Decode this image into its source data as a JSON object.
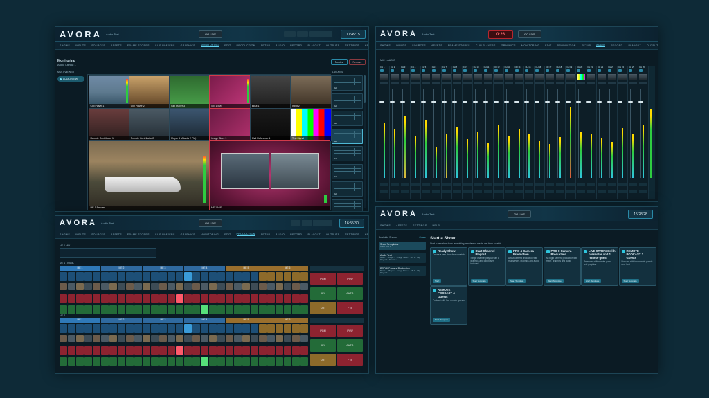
{
  "colors": {
    "accent": "#2fc6de",
    "bg": "#0e2a37",
    "red": "#c7303b",
    "green": "#2e9b47",
    "blue": "#28628f",
    "gold": "#9a6f2d"
  },
  "brand": {
    "logo": "AVORA",
    "sub": "Audio Test"
  },
  "common": {
    "go_live": "GO LIVE"
  },
  "panel_a": {
    "clock": "17:45:15",
    "nav": [
      "SHOWS",
      "INPUTS",
      "SOURCES",
      "ASSETS",
      "FRAME STORES",
      "CLIP PLAYERS",
      "GRAPHICS",
      "MONITORING",
      "EDIT",
      "PRODUCTION",
      "SETUP",
      "AUDIO",
      "RECORD",
      "PLAYOUT",
      "OUTPUTS",
      "SETTINGS",
      "HELP"
    ],
    "active_nav": "MONITORING",
    "title": "Monitoring",
    "subtitle": "Audio Layout 1",
    "sidebar_label": "MULTIVIEWER",
    "sidebar_item": "AUDIO VIEW",
    "action_primary": "Preview",
    "action_secondary": "Remove",
    "layouts_label": "LAYOUTS",
    "tiles": [
      {
        "label": "Clip Player 1",
        "sub": "Clip Player 1"
      },
      {
        "label": "Clip Player 2",
        "sub": "Clip Player 2"
      },
      {
        "label": "Clip Player 3",
        "sub": "Clip Player 3"
      },
      {
        "label": "ME 1 M/E",
        "sub": "ME 1 M/E"
      },
      {
        "label": "Input 1",
        "sub": "Input 1"
      },
      {
        "label": "Input 2",
        "sub": "Input 2"
      },
      {
        "label": "Remote Contributor 1",
        "sub": "Remote Contributor 1"
      },
      {
        "label": "Remote Contributor 2",
        "sub": "Remote Contributor 2"
      },
      {
        "label": "Player 4 (Atlanta 2 PM)",
        "sub": "Player 4 (Atlanta 2 PM)"
      },
      {
        "label": "Image Store 1",
        "sub": "Image Store 1"
      },
      {
        "label": "Mv1 Reference 1",
        "sub": "Mv1 Reference 1"
      },
      {
        "label": "Test Signal",
        "sub": "Test Signal"
      }
    ],
    "big_left": {
      "label": "ME 1 Preview",
      "caption": "ME 1 Preview"
    },
    "big_right": {
      "label": "ME 1 M/E",
      "caption": "ME 1 M/E"
    },
    "layout_labels": [
      "3x3",
      "3x3",
      "3x3",
      "4x4",
      "3x3",
      "4x4",
      "3x3",
      "3x3"
    ]
  },
  "panel_b": {
    "timer": "0:26",
    "nav": [
      "SHOWS",
      "INPUTS",
      "SOURCES",
      "ASSETS",
      "FRAME STORES",
      "CLIP PLAYERS",
      "GRAPHICS",
      "MONITORING",
      "EDIT",
      "PRODUCTION",
      "SETUP",
      "AUDIO",
      "RECORD",
      "PLAYOUT",
      "OUTPUTS",
      "SETTINGS"
    ],
    "active_nav": "AUDIO",
    "mixer_title": "MIC 1 AUDIO",
    "channels": [
      "CH 1",
      "CH 2",
      "CH 3",
      "CH 4",
      "CH 5",
      "CH 6",
      "CH 7",
      "CH 8",
      "CH 9",
      "CH 10",
      "CH 11",
      "CH 12",
      "CH 13",
      "CH 14",
      "CH 15",
      "CH 16",
      "CH 17",
      "CH 18",
      "CH 19",
      "CH 20",
      "CH 21",
      "CH 22",
      "CH 23",
      "CH 24",
      "CH 25",
      "CH 26"
    ],
    "levels": [
      0.62,
      0.55,
      0.7,
      0.48,
      0.66,
      0.35,
      0.5,
      0.58,
      0.44,
      0.52,
      0.4,
      0.6,
      0.47,
      0.55,
      0.5,
      0.42,
      0.38,
      0.46,
      0.8,
      0.52,
      0.5,
      0.45,
      0.41,
      0.56,
      0.49,
      0.6
    ]
  },
  "panel_c": {
    "clock": "16:55:30",
    "nav": [
      "SHOWS",
      "INPUTS",
      "SOURCES",
      "ASSETS",
      "FRAME STORES",
      "CLIP PLAYERS",
      "GRAPHICS",
      "MONITORING",
      "EDIT",
      "PRODUCTION",
      "SETUP",
      "AUDIO",
      "RECORD",
      "PLAYOUT",
      "OUTPUTS",
      "SETTINGS",
      "HELP"
    ],
    "active_nav": "PRODUCTION",
    "section_label": "ME 1 MIX",
    "bank_label": "ME 1 - BANK",
    "groups": [
      "ME 1",
      "ME 2",
      "ME 3",
      "ME 4",
      "ME 5",
      "ME 6"
    ],
    "bank2_label": "ME 2",
    "keys": [
      "PGM",
      "PVW",
      "KEY",
      "AUTO",
      "CUT",
      "FTB"
    ]
  },
  "panel_d": {
    "clock": "15:28:28",
    "nav": [
      "SHOWS",
      "ASSETS",
      "SETTINGS",
      "HELP"
    ],
    "sidebar_title": "Available Shows",
    "sidebar_new": "Create",
    "sidebar_items": [
      {
        "title": "Show Templates",
        "sub": "Audio Live 1"
      },
      {
        "title": "Audio Test",
        "sub": "Mixer 1 · Player 1 · Image Store 1 · Mv 1 · Clip Player 2 · Remote 1"
      },
      {
        "title": "PRO 8 Camera Production",
        "sub": "Mixer 1 · Player 1 · Image Store 1 · Mv 1 · Clip Player 2"
      }
    ],
    "title": "Start a Show",
    "subtitle": "Start a new show from an existing template or create one from scratch",
    "cards": [
      {
        "title": "Ready Show",
        "desc": "Create a new show from scratch",
        "go": "Start"
      },
      {
        "title": "Start Channel Playout",
        "desc": "Single channel playout with a graphics and clip player included",
        "go": "Start Template"
      },
      {
        "title": "PRO 4 Camera Production",
        "desc": "A four camera production with multiviewer, graphics and audio",
        "go": "Start Template"
      },
      {
        "title": "PRO 8 Camera Production",
        "desc": "An eight camera production with mixer, graphics and audio",
        "go": "Start Template"
      },
      {
        "title": "LIVE STREAM with presenter and 1 remote guest",
        "desc": "Presenter with remote guest and graphics",
        "go": "Start Template"
      },
      {
        "title": "REMOTE PODCAST 2 Guests",
        "desc": "Podcast with two remote guests and host",
        "go": "Start Template"
      },
      {
        "title": "REMOTE PODCAST 4 Guests",
        "desc": "Podcast with four remote guests",
        "go": "Start Template"
      }
    ]
  }
}
